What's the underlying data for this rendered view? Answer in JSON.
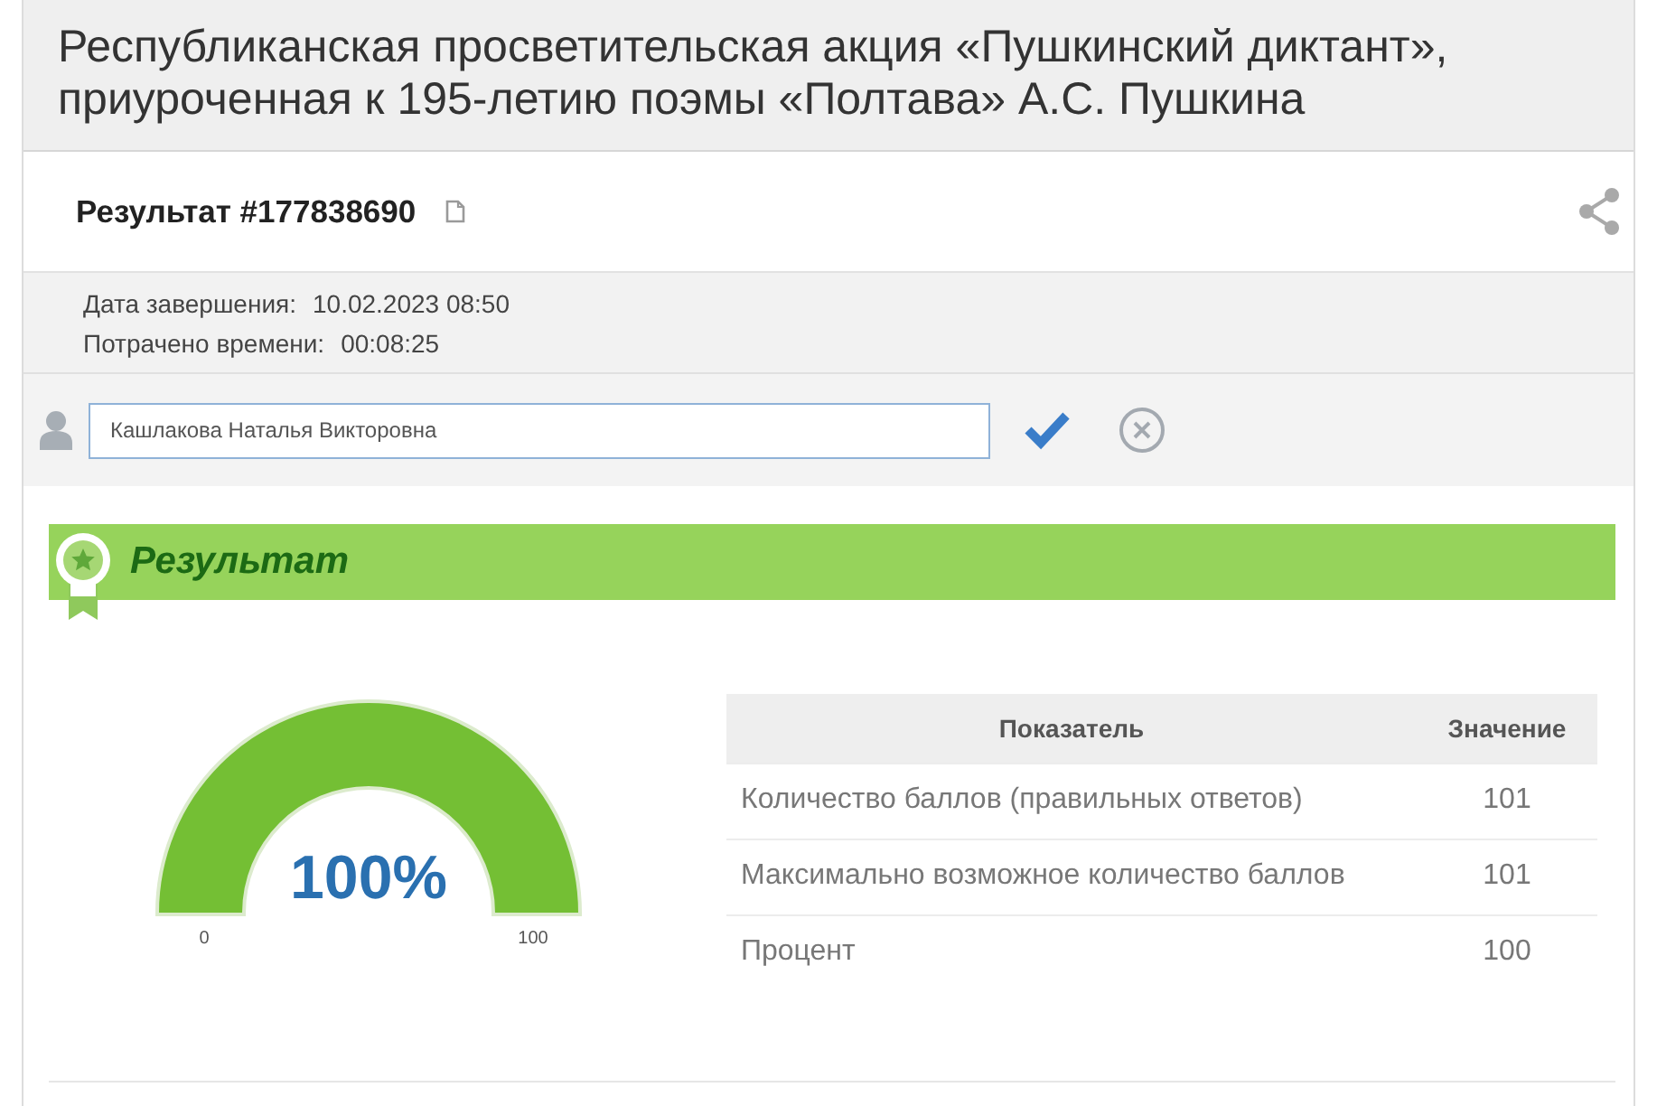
{
  "header": {
    "title": "Республиканская просветительская акция «Пушкинский диктант», приуроченная к 195-летию поэмы «Полтава» А.С. Пушкина"
  },
  "result": {
    "title": "Результат #177838690",
    "details": [
      {
        "label": "Дата завершения:",
        "value": "10.02.2023 08:50"
      },
      {
        "label": "Потрачено времени:",
        "value": "00:08:25"
      }
    ],
    "name_field": {
      "value": "Кашлакова Наталья Викторовна"
    }
  },
  "summary": {
    "heading": "Результат",
    "gauge": {
      "level": 1,
      "reading": "100%",
      "min_label": "0",
      "max_label": "100"
    },
    "table": {
      "columns": [
        "Показатель",
        "Значение"
      ],
      "rows": [
        {
          "indicator": "Количество баллов (правильных ответов)",
          "value": "101"
        },
        {
          "indicator": "Максимально возможное количество баллов",
          "value": "101"
        },
        {
          "indicator": "Процент",
          "value": "100"
        }
      ]
    }
  }
}
